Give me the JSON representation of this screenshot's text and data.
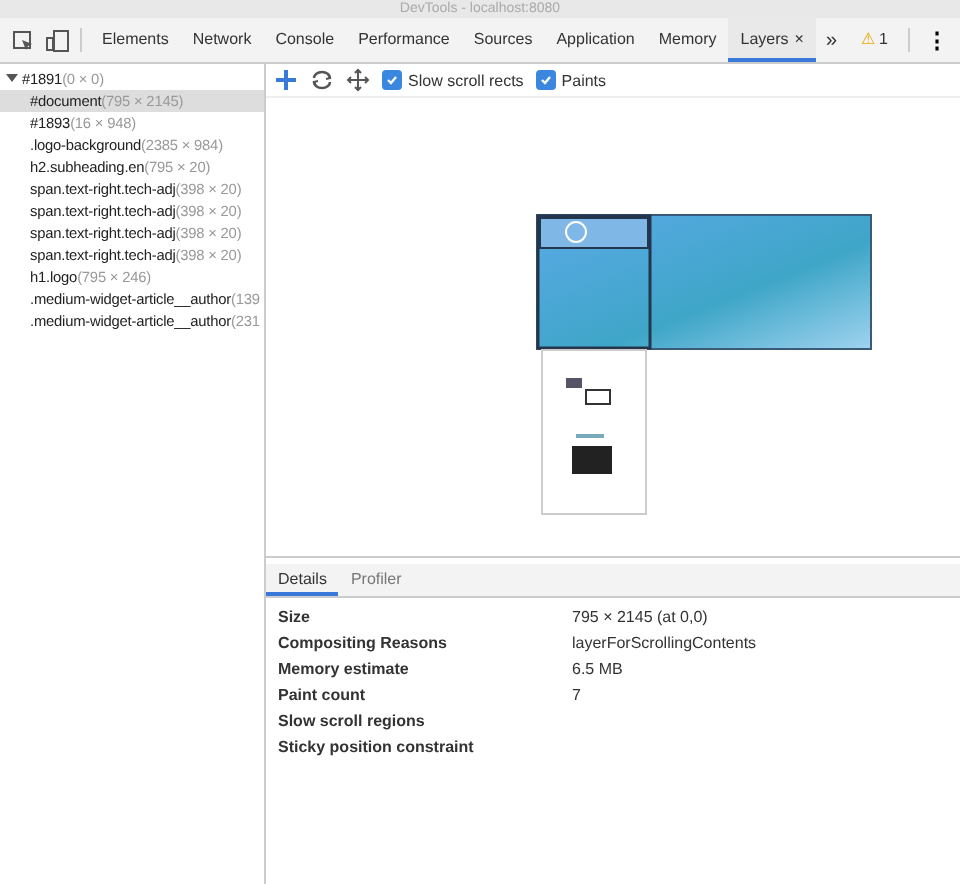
{
  "window": {
    "title": "DevTools - localhost:8080"
  },
  "tabs": [
    {
      "label": "Elements",
      "selected": false
    },
    {
      "label": "Network",
      "selected": false
    },
    {
      "label": "Console",
      "selected": false
    },
    {
      "label": "Performance",
      "selected": false
    },
    {
      "label": "Sources",
      "selected": false
    },
    {
      "label": "Application",
      "selected": false
    },
    {
      "label": "Memory",
      "selected": false
    },
    {
      "label": "Layers",
      "selected": true,
      "close": "×"
    }
  ],
  "more_tabs": "»",
  "warnings": {
    "icon": "⚠",
    "count": "1"
  },
  "menu": "⋮",
  "layer_tree": {
    "label": "#1891",
    "size": "(0 × 0)",
    "expanded": true,
    "children": [
      {
        "label": "#document",
        "size": "(795 × 2145)",
        "selected": true
      },
      {
        "label": "#1893",
        "size": "(16 × 948)",
        "selected": false
      },
      {
        "label": ".logo-background",
        "size": "(2385 × 984)",
        "selected": false
      },
      {
        "label": "h2.subheading.en",
        "size": "(795 × 20)",
        "selected": false
      },
      {
        "label": "span.text-right.tech-adj",
        "size": "(398 × 20)",
        "selected": false
      },
      {
        "label": "span.text-right.tech-adj",
        "size": "(398 × 20)",
        "selected": false
      },
      {
        "label": "span.text-right.tech-adj",
        "size": "(398 × 20)",
        "selected": false
      },
      {
        "label": "span.text-right.tech-adj",
        "size": "(398 × 20)",
        "selected": false
      },
      {
        "label": "h1.logo",
        "size": "(795 × 246)",
        "selected": false
      },
      {
        "label": ".medium-widget-article__author",
        "size": "(139",
        "selected": false
      },
      {
        "label": ".medium-widget-article__author",
        "size": "(231",
        "selected": false
      }
    ]
  },
  "layer_toolbar": {
    "tools": [
      {
        "kind": "pan",
        "selected": true
      },
      {
        "kind": "rotate",
        "selected": false
      },
      {
        "kind": "move",
        "selected": false
      }
    ],
    "options": [
      {
        "label": "Slow scroll rects",
        "checked": true
      },
      {
        "label": "Paints",
        "checked": true
      }
    ]
  },
  "details_tabs": [
    {
      "label": "Details",
      "selected": true
    },
    {
      "label": "Profiler",
      "selected": false
    }
  ],
  "details": [
    {
      "name": "Size",
      "value": "795 × 2145 (at 0,0)"
    },
    {
      "name": "Compositing Reasons",
      "value": "layerForScrollingContents"
    },
    {
      "name": "Memory estimate",
      "value": "6.5 MB"
    },
    {
      "name": "Paint count",
      "value": "7"
    },
    {
      "name": "Slow scroll regions"
    },
    {
      "name": "Sticky position constraint"
    }
  ]
}
